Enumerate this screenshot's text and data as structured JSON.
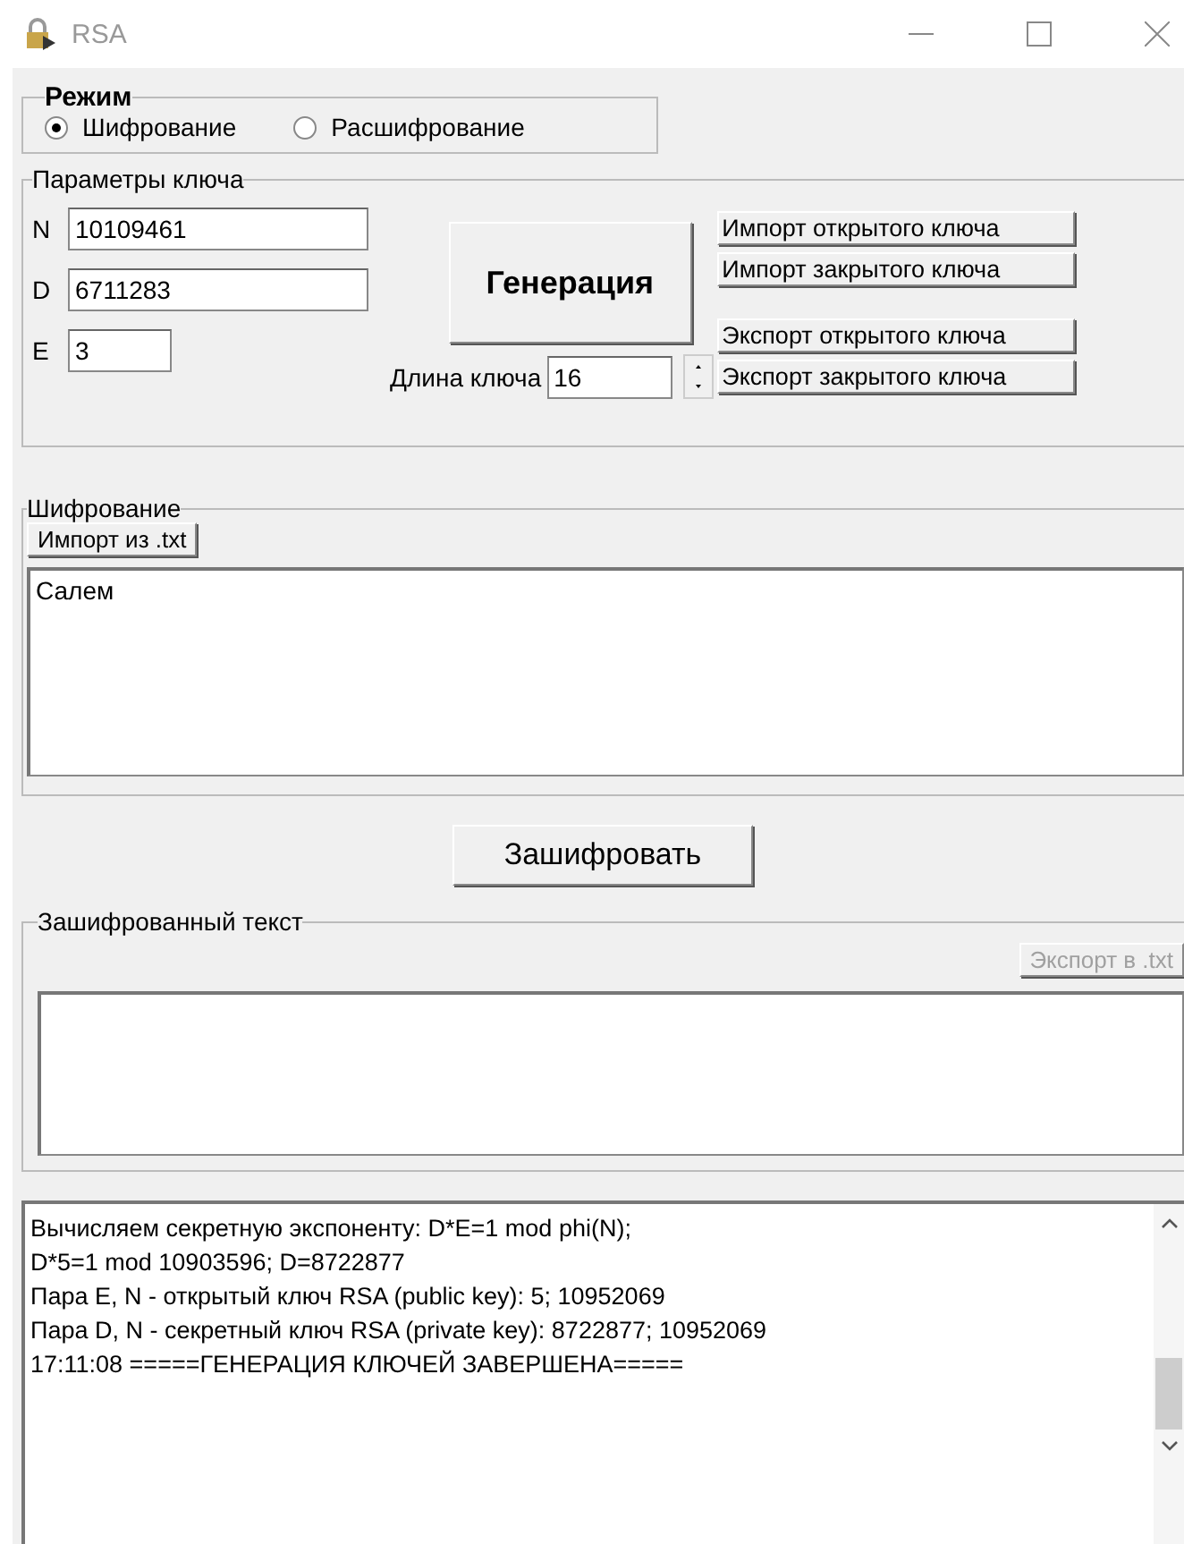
{
  "window": {
    "title": "RSA"
  },
  "mode": {
    "title": "Режим",
    "options": [
      {
        "label": "Шифрование",
        "selected": true
      },
      {
        "label": "Расшифрование",
        "selected": false
      }
    ]
  },
  "key_params": {
    "title": "Параметры ключа",
    "fields": [
      {
        "label": "N",
        "value": "10109461"
      },
      {
        "label": "D",
        "value": "6711283"
      },
      {
        "label": "E",
        "value": "3"
      }
    ],
    "generate_button": "Генерация",
    "key_length": {
      "label": "Длина ключа",
      "value": "16"
    },
    "import_buttons": [
      "Импорт открытого ключа",
      "Импорт закрытого ключа"
    ],
    "export_buttons": [
      "Экспорт открытого ключа",
      "Экспорт закрытого ключа"
    ]
  },
  "encryption": {
    "title": "Шифрование",
    "import_button": "Импорт из .txt",
    "text": "Салем"
  },
  "encrypt_button": "Зашифровать",
  "encrypted": {
    "title": "Зашифрованный текст",
    "export_button": {
      "label": "Экспорт в .txt",
      "disabled": true
    }
  },
  "log": {
    "lines": [
      "Вычисляем секретную экспоненту: D*E=1 mod phi(N);",
      "D*5=1 mod 10903596; D=8722877",
      "Пара E, N - открытый ключ RSA (public key): 5; 10952069",
      "Пара D, N - секретный ключ RSA (private key): 8722877; 10952069",
      "17:11:08 =====ГЕНЕРАЦИЯ КЛЮЧЕЙ ЗАВЕРШЕНА====="
    ]
  }
}
